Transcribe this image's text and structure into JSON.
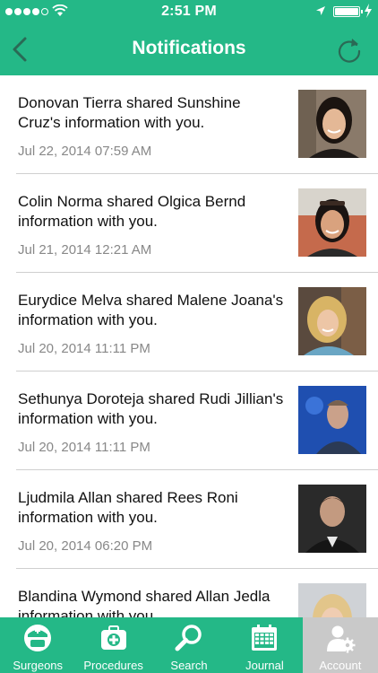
{
  "status_bar": {
    "signal_dots_filled": 4,
    "signal_dots_total": 5,
    "time": "2:51 PM",
    "battery_level_percent": 100,
    "charging": true,
    "location_icon": "location-arrow-icon"
  },
  "nav": {
    "title": "Notifications",
    "back_icon": "chevron-left-icon",
    "refresh_icon": "refresh-icon"
  },
  "notifications": [
    {
      "message": "Donovan Tierra shared Sunshine Cruz's information with you.",
      "date": "Jul 22, 2014 07:59 AM"
    },
    {
      "message": "Colin Norma shared Olgica Bernd information with you.",
      "date": "Jul 21, 2014 12:21 AM"
    },
    {
      "message": "Eurydice Melva shared Malene Joana's information with you.",
      "date": "Jul 20, 2014 11:11 PM"
    },
    {
      "message": "Sethunya Doroteja shared Rudi Jillian's information with you.",
      "date": "Jul 20, 2014 11:11 PM"
    },
    {
      "message": "Ljudmila Allan shared Rees Roni information with you.",
      "date": "Jul 20, 2014 06:20 PM"
    },
    {
      "message": "Blandina Wymond shared Allan Jedla information with you.",
      "date": ""
    }
  ],
  "tabs": [
    {
      "label": "Surgeons",
      "icon": "surgeon-icon",
      "active": false
    },
    {
      "label": "Procedures",
      "icon": "medical-kit-icon",
      "active": false
    },
    {
      "label": "Search",
      "icon": "search-icon",
      "active": false
    },
    {
      "label": "Journal",
      "icon": "calendar-icon",
      "active": false
    },
    {
      "label": "Account",
      "icon": "account-settings-icon",
      "active": true
    }
  ],
  "colors": {
    "brand_green": "#24b887",
    "active_tab": "#c9c9c9",
    "date_gray": "#888888",
    "separator": "#cfcfcf"
  }
}
